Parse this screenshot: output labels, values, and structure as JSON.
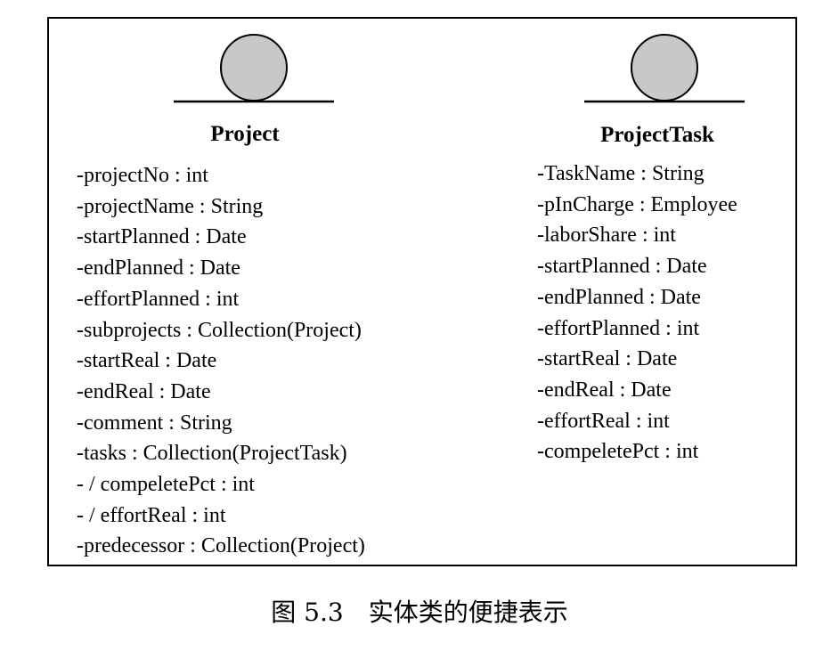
{
  "colors": {
    "circle_fill": "#c8c8c8",
    "stroke": "#000000",
    "background": "#ffffff"
  },
  "entities": [
    {
      "icon": "entity-circle-icon",
      "name": "Project",
      "attributes": [
        "-projectNo : int",
        "-projectName : String",
        "-startPlanned : Date",
        "-endPlanned : Date",
        "-effortPlanned : int",
        "-subprojects : Collection(Project)",
        "-startReal : Date",
        "-endReal : Date",
        "-comment : String",
        "-tasks : Collection(ProjectTask)",
        "- / compeletePct : int",
        "- / effortReal : int",
        "-predecessor : Collection(Project)"
      ]
    },
    {
      "icon": "entity-circle-icon",
      "name": "ProjectTask",
      "attributes": [
        "-TaskName : String",
        "-pInCharge : Employee",
        "-laborShare : int",
        "-startPlanned : Date",
        "-endPlanned : Date",
        "-effortPlanned : int",
        "-startReal : Date",
        "-endReal : Date",
        "-effortReal : int",
        "-compeletePct : int"
      ]
    }
  ],
  "caption": "图 5.3　实体类的便捷表示"
}
